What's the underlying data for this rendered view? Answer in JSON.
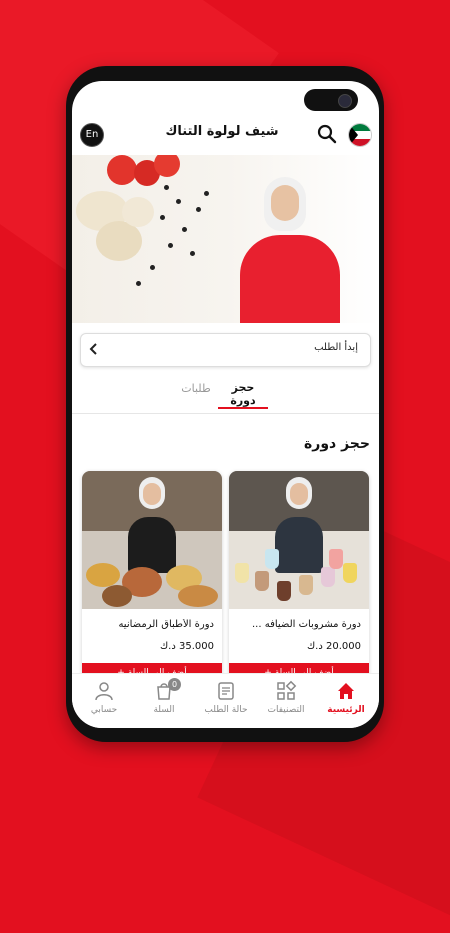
{
  "header": {
    "title": "شيف لولوة التناك",
    "lang_button": "En",
    "search_icon": "search-icon",
    "flag_icon": "kuwait-flag-icon"
  },
  "order": {
    "label": "إبدأ الطلب",
    "chevron_icon": "chevron-left-icon"
  },
  "tabs": [
    {
      "label": "حجز دورة",
      "active": true
    },
    {
      "label": "طلبات",
      "active": false
    }
  ],
  "section": {
    "title": "حجز دورة"
  },
  "courses": [
    {
      "name": "دورة مشروبات الضيافه ...",
      "price": "20.000 د.ك",
      "button": "أضف إلى السلة +"
    },
    {
      "name": "دورة الأطباق الرمضانيه",
      "price": "35.000 د.ك",
      "button": "أضف إلى السلة +"
    }
  ],
  "bottom_nav": [
    {
      "label": "الرئيسية",
      "icon": "home-icon",
      "active": true
    },
    {
      "label": "التصنيفات",
      "icon": "categories-icon",
      "active": false
    },
    {
      "label": "حالة الطلب",
      "icon": "order-status-icon",
      "active": false
    },
    {
      "label": "السلة",
      "icon": "cart-icon",
      "active": false,
      "badge": "0"
    },
    {
      "label": "حسابي",
      "icon": "user-icon",
      "active": false
    }
  ],
  "colors": {
    "brand": "#e3101f",
    "text": "#111111",
    "muted": "#888888"
  }
}
